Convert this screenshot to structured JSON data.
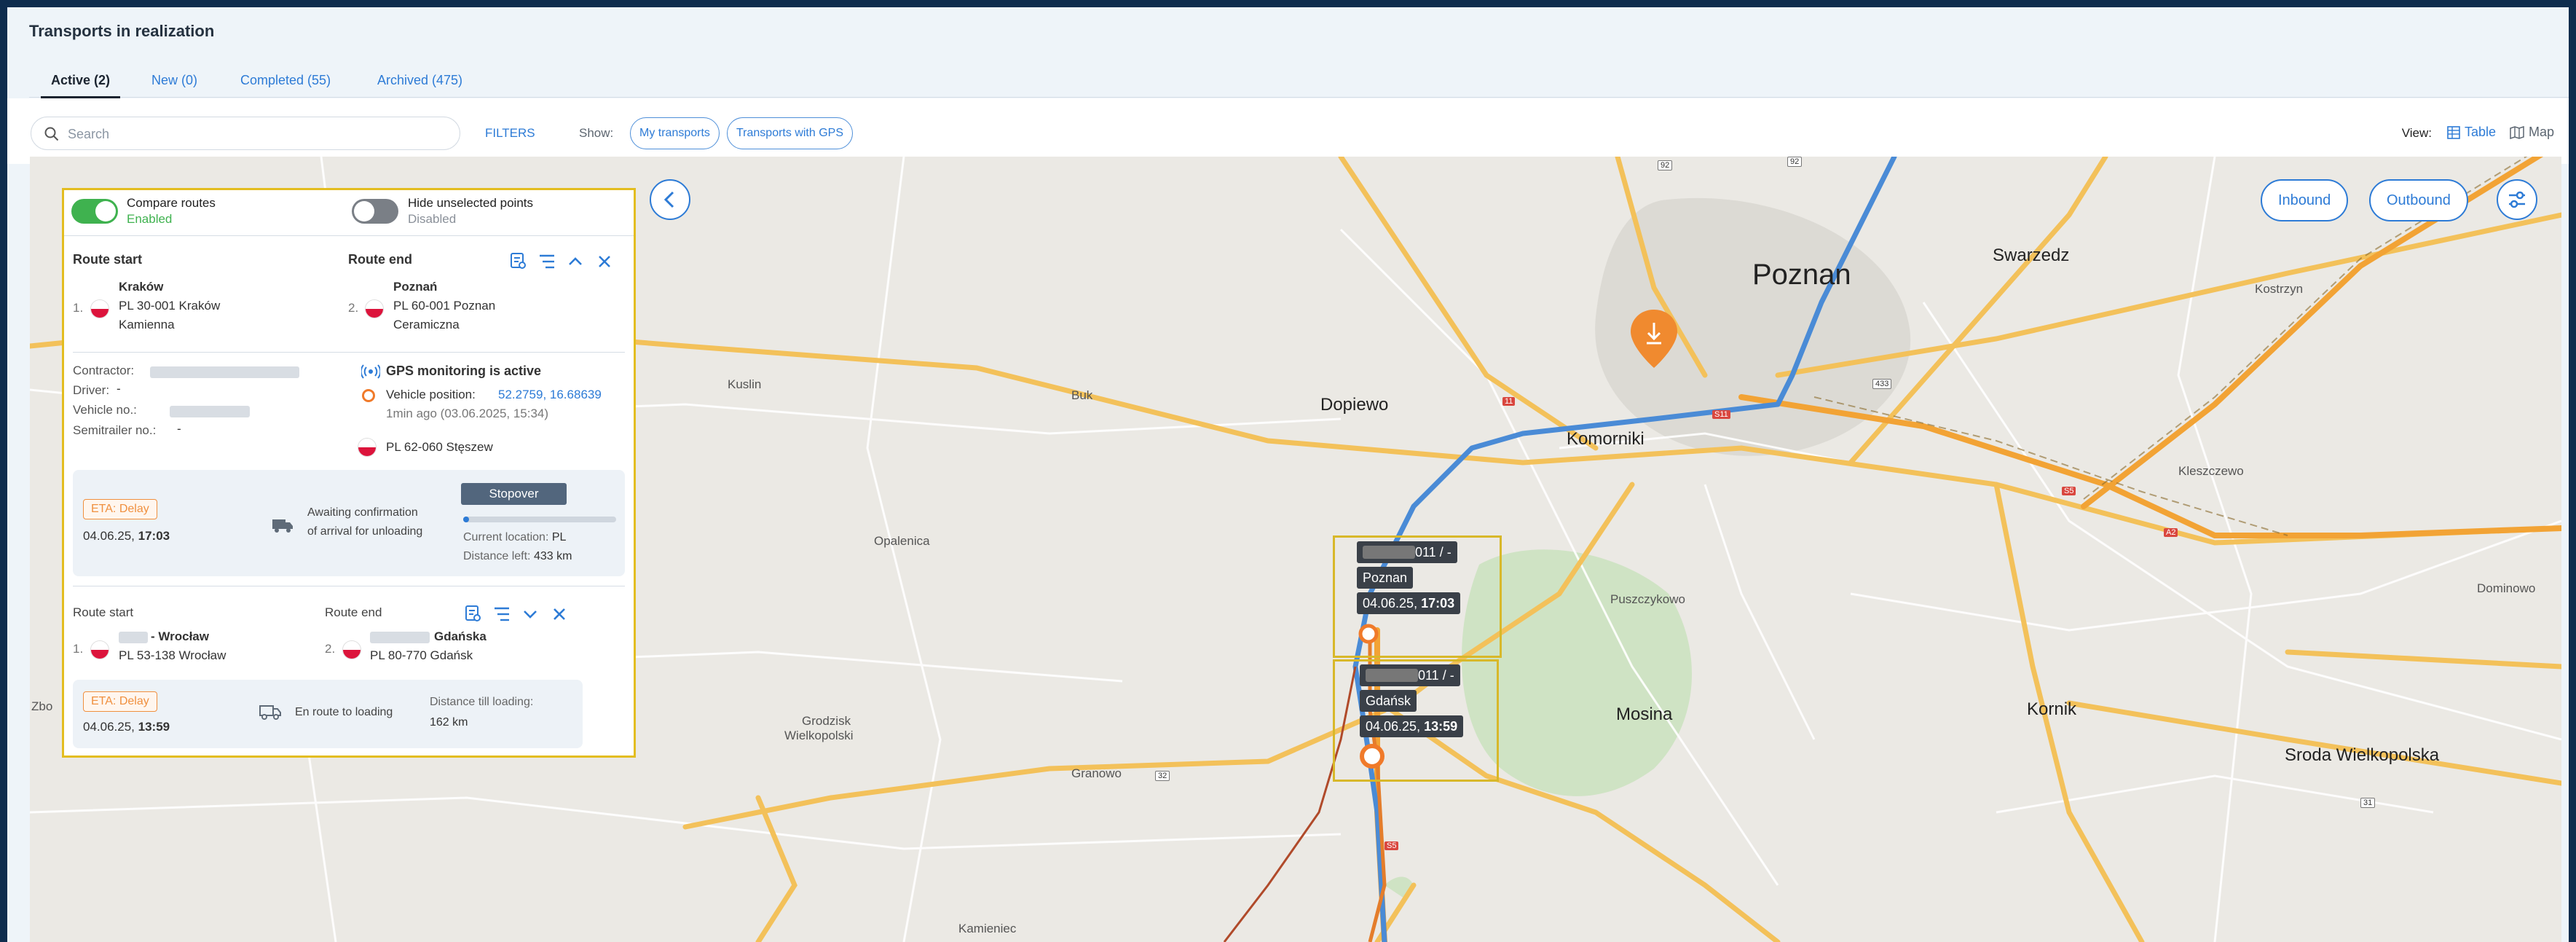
{
  "header": {
    "title": "Transports in realization"
  },
  "tabs": [
    {
      "label": "Active (2)",
      "active": true
    },
    {
      "label": "New (0)"
    },
    {
      "label": "Completed (55)"
    },
    {
      "label": "Archived (475)"
    }
  ],
  "toolbar": {
    "search_placeholder": "Search",
    "filters_label": "FILTERS",
    "show_label": "Show:",
    "my_transports": "My transports",
    "with_gps": "Transports with GPS",
    "view_label": "View:",
    "view_table": "Table",
    "view_map": "Map"
  },
  "panel": {
    "compare": {
      "title": "Compare routes",
      "state": "Enabled",
      "on": true
    },
    "hide_unselected": {
      "title": "Hide unselected points",
      "state": "Disabled",
      "on": false
    },
    "transport1": {
      "start_label": "Route start",
      "end_label": "Route end",
      "start": {
        "num": "1.",
        "city": "Kraków",
        "addr1": "PL 30-001 Kraków",
        "addr2": "Kamienna"
      },
      "end": {
        "num": "2.",
        "city": "Poznań",
        "addr1": "PL 60-001 Poznan",
        "addr2": "Ceramiczna"
      },
      "contractor_label": "Contractor:",
      "driver_label": "Driver:",
      "driver_value": "-",
      "vehicle_label": "Vehicle no.:",
      "semitrailer_label": "Semitrailer no.:",
      "semitrailer_value": "-",
      "gps_title": "GPS monitoring is active",
      "vehicle_position_label": "Vehicle position:",
      "vehicle_position_value": "52.2759, 16.68639",
      "updated": "1min ago (03.06.2025, 15:34)",
      "location": "PL 62-060 Stęszew",
      "eta_badge": "ETA: Delay",
      "eta_date": "04.06.25,",
      "eta_time": "17:03",
      "status_line1": "Awaiting confirmation",
      "status_line2": "of arrival for unloading",
      "stopover": "Stopover",
      "current_location_label": "Current location:",
      "current_location_value": "PL",
      "distance_left_label": "Distance left:",
      "distance_left_value": "433 km"
    },
    "transport2": {
      "start_label": "Route start",
      "end_label": "Route end",
      "start": {
        "num": "1.",
        "city": "- Wrocław",
        "addr1": "PL 53-138 Wrocław"
      },
      "end": {
        "num": "2.",
        "city": "Gdańska",
        "addr1": "PL 80-770 Gdańsk"
      },
      "eta_badge": "ETA: Delay",
      "eta_date": "04.06.25,",
      "eta_time": "13:59",
      "status": "En route to loading",
      "distance_label": "Distance till loading:",
      "distance_value": "162 km"
    }
  },
  "map": {
    "inbound": "Inbound",
    "outbound": "Outbound",
    "marker1": {
      "id": "011 / -",
      "city": "Poznan",
      "date": "04.06.25,",
      "time": "17:03"
    },
    "marker2": {
      "id": "011 / -",
      "city": "Gdańsk",
      "date": "04.06.25,",
      "time": "13:59"
    },
    "cities": {
      "poznan": "Poznan",
      "swarzedz": "Swarzedz",
      "kostrzyn": "Kostrzyn",
      "dopiewo": "Dopiewo",
      "komorniki": "Komorniki",
      "kuslin": "Kuslin",
      "buk": "Buk",
      "opalenica": "Opalenica",
      "kleszczewo": "Kleszczewo",
      "puszczykowo": "Puszczykowo",
      "mosina": "Mosina",
      "kornik": "Kornik",
      "dominowo": "Dominowo",
      "sroda": "Sroda Wielkopolska",
      "grodzisk1": "Grodzisk",
      "grodzisk2": "Wielkopolski",
      "granowo": "Granowo",
      "kamieniec": "Kamieniec",
      "zbo": "Zbo"
    },
    "roads": {
      "r92a": "92",
      "r92b": "92",
      "r433": "433",
      "r11": "11",
      "s5": "S5",
      "a2": "A2",
      "s11": "S11",
      "r32": "32",
      "r31": "31",
      "s5b": "S5"
    },
    "colors": {
      "route_primary": "#4a8bd6",
      "route_secondary": "#f08a2f",
      "accent": "#2d7bd6",
      "highlight": "#d8b82a"
    }
  }
}
